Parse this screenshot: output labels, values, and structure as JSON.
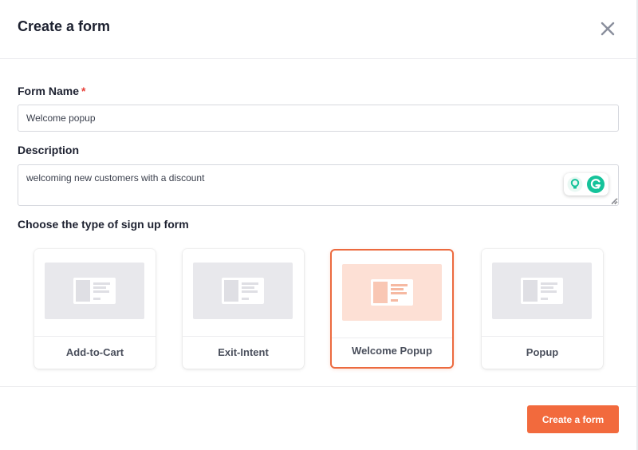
{
  "modal": {
    "title": "Create a form"
  },
  "form": {
    "name_label": "Form Name",
    "required_marker": "*",
    "name_value": "Welcome popup",
    "description_label": "Description",
    "description_value": "welcoming new customers with a discount"
  },
  "signup": {
    "section_label": "Choose the type of sign up form",
    "types": [
      {
        "label": "Add-to-Cart",
        "selected": false
      },
      {
        "label": "Exit-Intent",
        "selected": false
      },
      {
        "label": "Welcome Popup",
        "selected": true
      },
      {
        "label": "Popup",
        "selected": false
      }
    ]
  },
  "footer": {
    "submit_label": "Create a form"
  },
  "icons": {
    "close": "close-icon",
    "assist_bulb": "lightbulb-icon",
    "assist_g": "grammar-assistant-icon",
    "card_preview": "popup-layout-icon"
  },
  "colors": {
    "accent": "#f26a3d",
    "selected_border": "#ec6a3f",
    "selected_preview": "#fde0d5",
    "required": "#e8413a",
    "assist_green": "#15c39a"
  }
}
